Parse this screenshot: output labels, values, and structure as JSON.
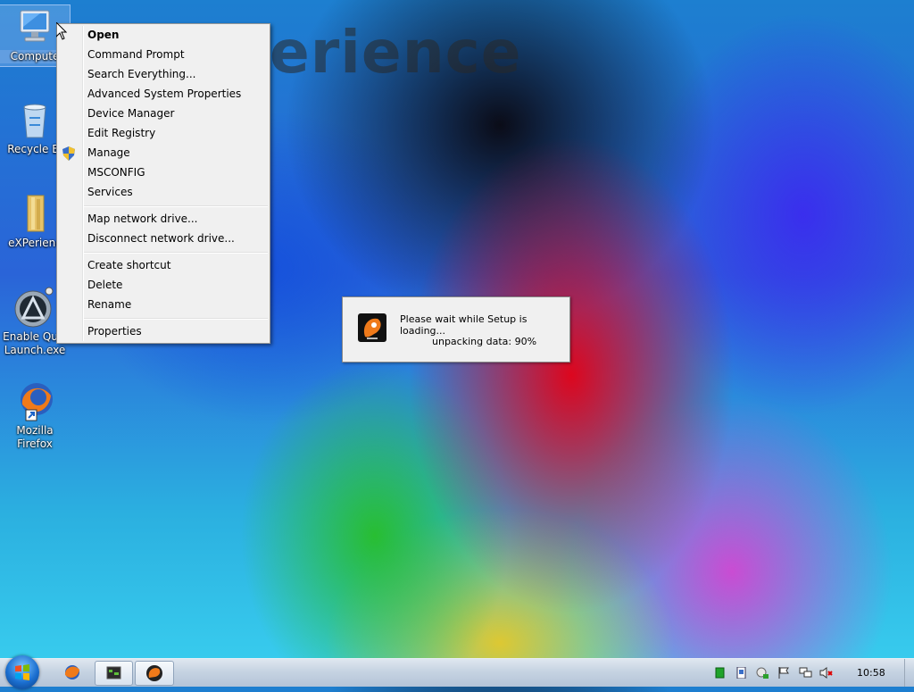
{
  "watermark": "erience",
  "desktop_icons": [
    {
      "label": "Compute",
      "icon": "computer-icon"
    },
    {
      "label": "Recycle Bi",
      "icon": "recycle-bin-icon"
    },
    {
      "label": "eXPerienc",
      "icon": "folder-icon"
    },
    {
      "label1": "Enable Quic",
      "label2": "Launch.exe",
      "icon": "quicklaunch-icon"
    },
    {
      "label1": "Mozilla",
      "label2": "Firefox",
      "icon": "firefox-icon"
    }
  ],
  "context_menu": {
    "items": [
      "Open",
      "Command Prompt",
      "Search Everything...",
      "Advanced System Properties",
      "Device Manager",
      "Edit Registry",
      "Manage",
      "MSCONFIG",
      "Services",
      "Map network drive...",
      "Disconnect network drive...",
      "Create shortcut",
      "Delete",
      "Rename",
      "Properties"
    ]
  },
  "setup_dialog": {
    "line1": "Please wait while Setup is loading...",
    "line2": "unpacking data: 90%"
  },
  "taskbar": {
    "clock": "10:58"
  },
  "colors": {
    "menu_bg": "#f0f0f0",
    "taskbar_top": "#dfe7f0"
  }
}
